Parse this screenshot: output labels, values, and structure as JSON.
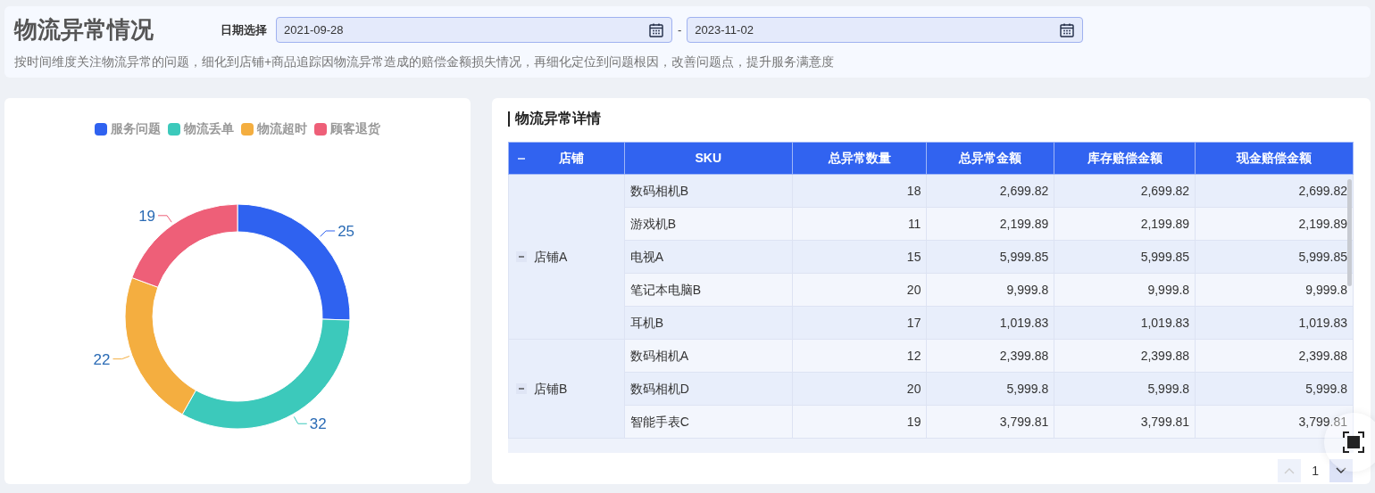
{
  "header": {
    "title": "物流异常情况",
    "date_label": "日期选择",
    "start_date": "2021-09-28",
    "separator": "-",
    "end_date": "2023-11-02",
    "description": "按时间维度关注物流异常的问题，细化到店铺+商品追踪因物流异常造成的赔偿金额损失情况，再细化定位到问题根因，改善问题点，提升服务满意度"
  },
  "donut": {
    "chart_data": {
      "type": "donut",
      "categories": [
        "服务问题",
        "物流丢单",
        "物流超时",
        "顾客退货"
      ],
      "series": [
        {
          "values": [
            25,
            32,
            22,
            19
          ]
        }
      ],
      "colors": [
        "#2f62f0",
        "#3cc9bb",
        "#f4ae40",
        "#ee5f78"
      ],
      "data_labels": true
    }
  },
  "detail": {
    "title": "物流异常详情",
    "header_expanded": true,
    "columns": [
      "店铺",
      "SKU",
      "总异常数量",
      "总异常金额",
      "库存赔偿金额",
      "现金赔偿金额"
    ],
    "groups": [
      {
        "store": "店铺A",
        "expanded": true,
        "rows": [
          [
            "数码相机B",
            "18",
            "2,699.82",
            "2,699.82",
            "2,699.82"
          ],
          [
            "游戏机B",
            "11",
            "2,199.89",
            "2,199.89",
            "2,199.89"
          ],
          [
            "电视A",
            "15",
            "5,999.85",
            "5,999.85",
            "5,999.85"
          ],
          [
            "笔记本电脑B",
            "20",
            "9,999.8",
            "9,999.8",
            "9,999.8"
          ],
          [
            "耳机B",
            "17",
            "1,019.83",
            "1,019.83",
            "1,019.83"
          ]
        ]
      },
      {
        "store": "店铺B",
        "expanded": true,
        "rows": [
          [
            "数码相机A",
            "12",
            "2,399.88",
            "2,399.88",
            "2,399.88"
          ],
          [
            "数码相机D",
            "20",
            "5,999.8",
            "5,999.8",
            "5,999.8"
          ],
          [
            "智能手表C",
            "19",
            "3,799.81",
            "3,799.81",
            "3,799.81"
          ]
        ]
      }
    ],
    "pagination": {
      "page": "1",
      "prev_disabled": true,
      "next_disabled": false
    }
  }
}
